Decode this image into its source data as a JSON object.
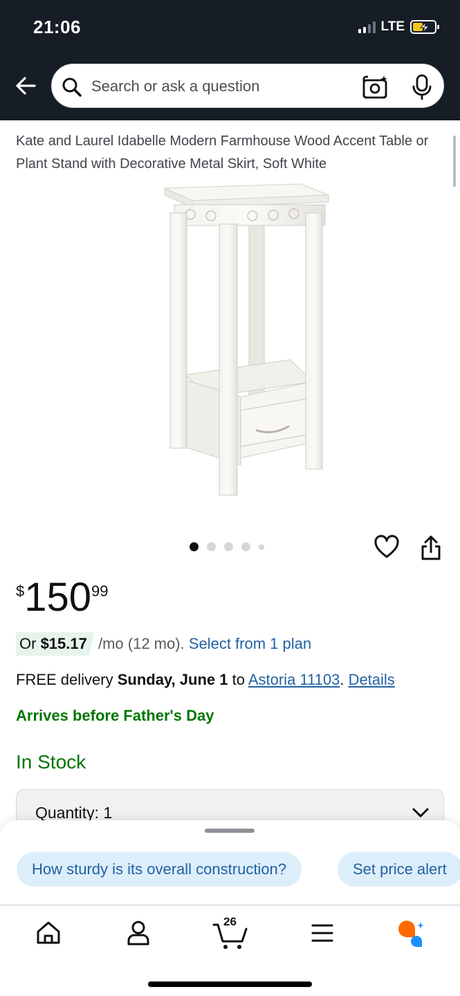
{
  "status_bar": {
    "time": "21:06",
    "network": "LTE"
  },
  "search": {
    "placeholder": "Search or ask a question"
  },
  "product": {
    "title": "Kate and Laurel Idabelle Modern Farmhouse Wood Accent Table or Plant Stand with Decorative Metal Skirt, Soft White",
    "image_count": 5,
    "active_image": 1
  },
  "price": {
    "symbol": "$",
    "whole": "150",
    "fraction": "99"
  },
  "installment": {
    "prefix": "Or ",
    "amount": "$15.17",
    "term": " /mo (12 mo). ",
    "link": "Select from 1 plan"
  },
  "delivery": {
    "prefix": "FREE delivery ",
    "date": "Sunday, June 1",
    "to": " to ",
    "location": "Astoria 11103",
    "sep": ". ",
    "details": "Details"
  },
  "arrives": "Arrives before Father's Day",
  "stock": "In Stock",
  "quantity": {
    "label": "Quantity:",
    "value": "1",
    "display": "Quantity: 1"
  },
  "suggestions": [
    "How sturdy is its overall construction?",
    "Set price alert"
  ],
  "nav": {
    "cart_count": "26"
  },
  "colors": {
    "header_bg": "#161D26",
    "link": "#2162A1",
    "green": "#007600",
    "chip_bg": "#DDEEFB",
    "rufus_orange": "#FF6A00",
    "rufus_blue": "#1E90FF"
  }
}
